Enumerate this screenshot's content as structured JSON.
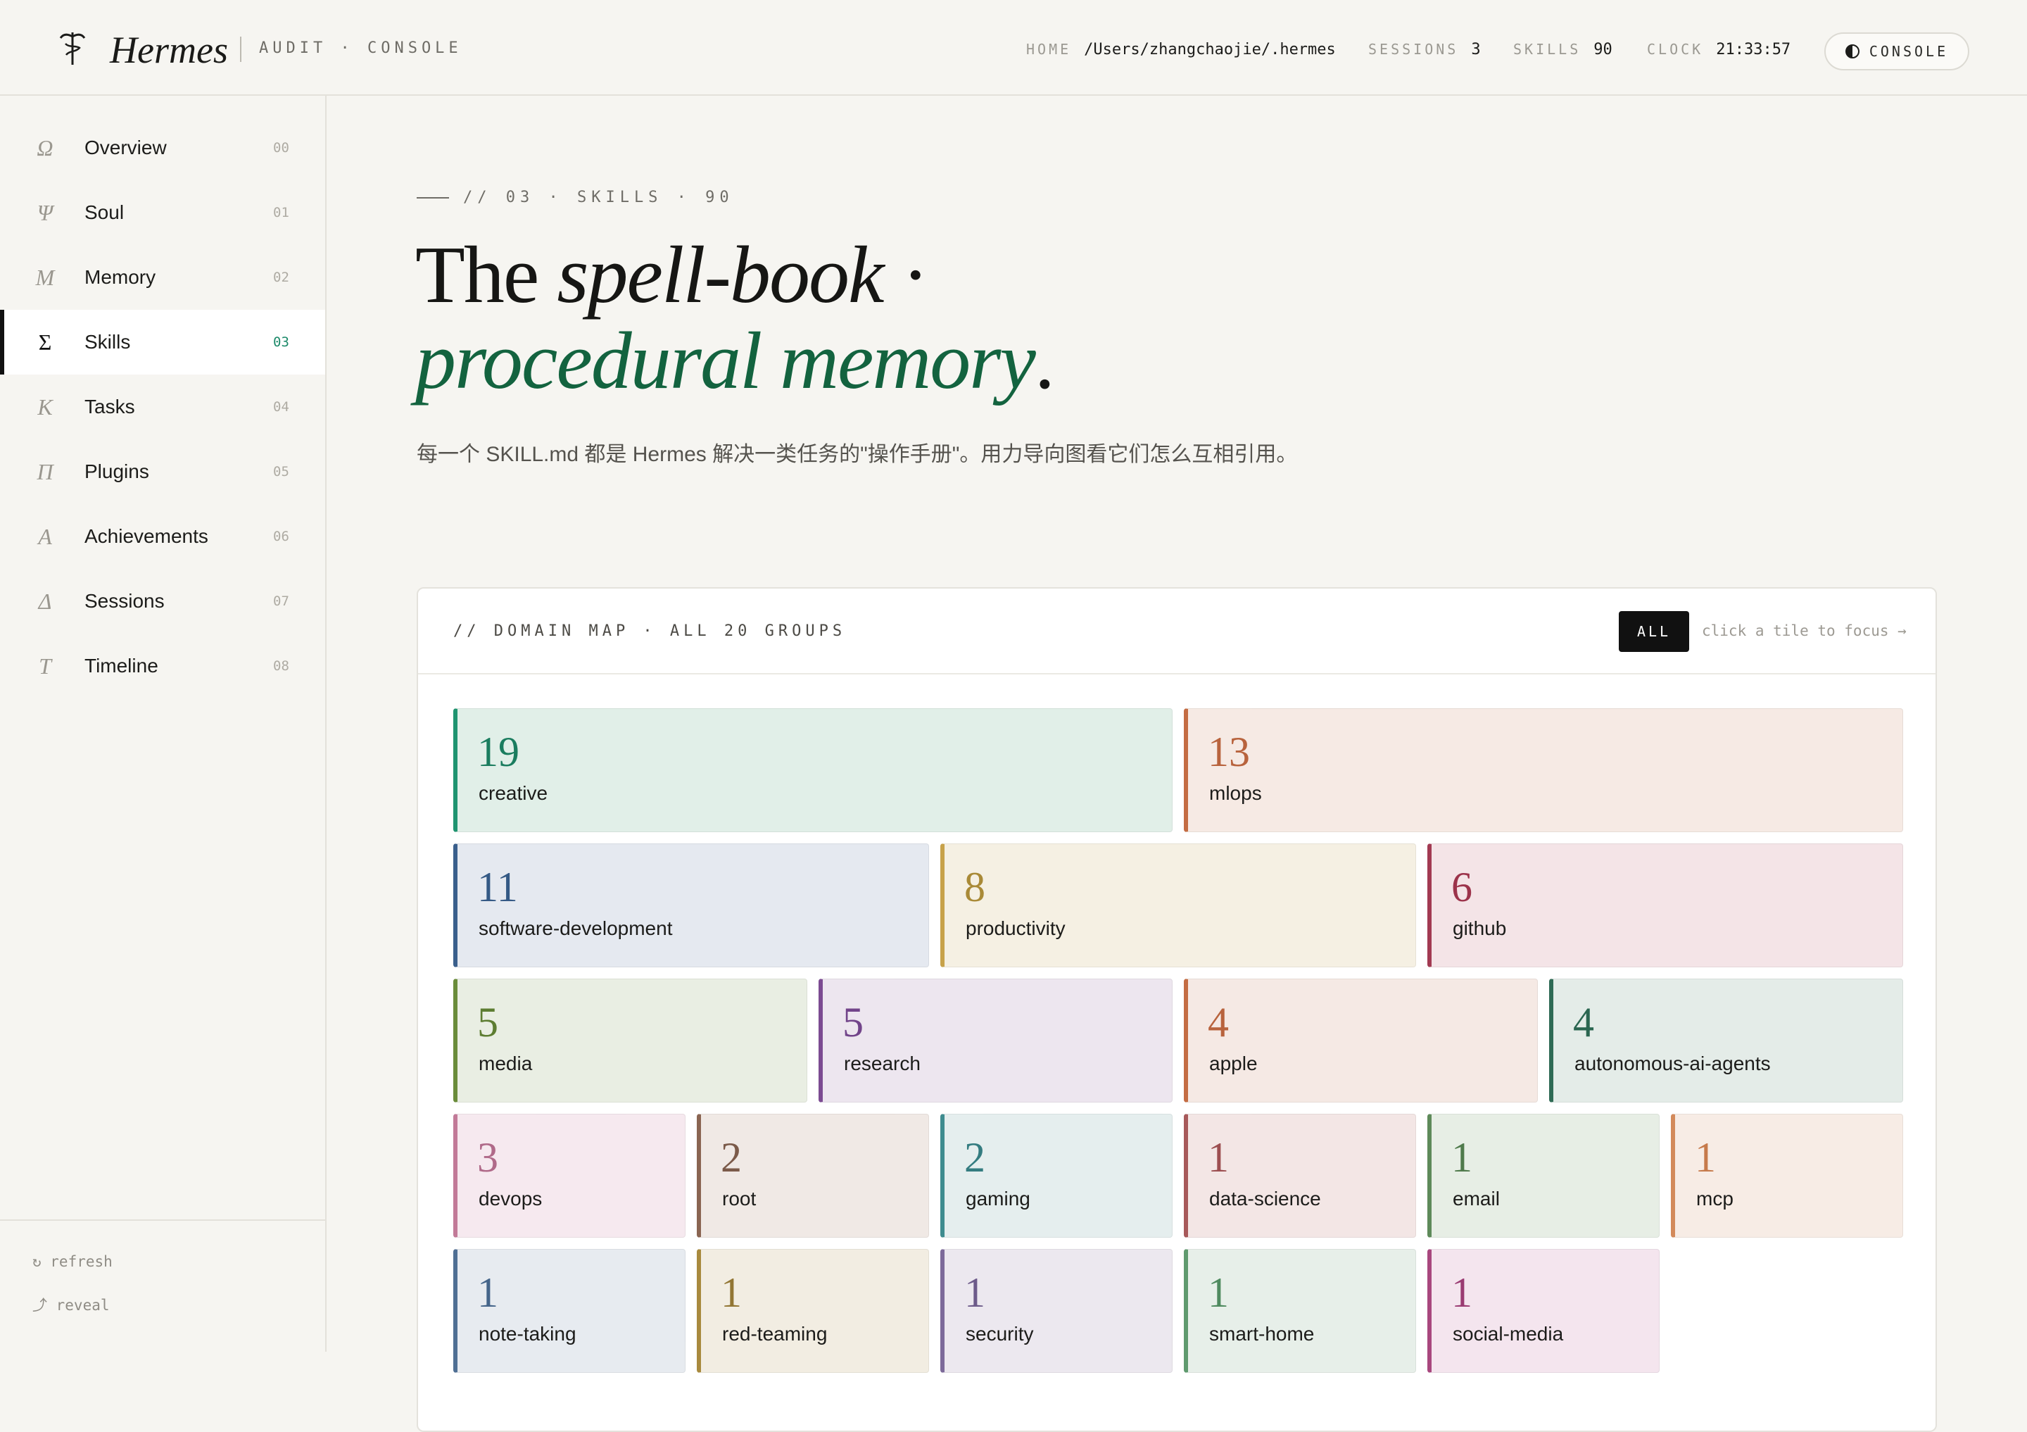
{
  "topbar": {
    "brand": "Hermes",
    "subtitle": "AUDIT · CONSOLE",
    "stats": [
      {
        "key": "HOME",
        "value": "/Users/zhangchaojie/.hermes"
      },
      {
        "key": "SESSIONS",
        "value": "3"
      },
      {
        "key": "SKILLS",
        "value": "90"
      },
      {
        "key": "CLOCK",
        "value": "21:33:57"
      }
    ],
    "console_label": "CONSOLE"
  },
  "sidebar": {
    "items": [
      {
        "glyph": "Ω",
        "label": "Overview",
        "num": "00",
        "active": false
      },
      {
        "glyph": "Ψ",
        "label": "Soul",
        "num": "01",
        "active": false
      },
      {
        "glyph": "M",
        "label": "Memory",
        "num": "02",
        "active": false
      },
      {
        "glyph": "Σ",
        "label": "Skills",
        "num": "03",
        "active": true
      },
      {
        "glyph": "K",
        "label": "Tasks",
        "num": "04",
        "active": false
      },
      {
        "glyph": "Π",
        "label": "Plugins",
        "num": "05",
        "active": false
      },
      {
        "glyph": "A",
        "label": "Achievements",
        "num": "06",
        "active": false
      },
      {
        "glyph": "Δ",
        "label": "Sessions",
        "num": "07",
        "active": false
      },
      {
        "glyph": "T",
        "label": "Timeline",
        "num": "08",
        "active": false
      }
    ],
    "footer": {
      "refresh": "↻ refresh",
      "reveal": "⤴ reveal"
    }
  },
  "main": {
    "crumb": "// 03 · SKILLS · 90",
    "hero_line1_plain": "The ",
    "hero_line1_italic": "spell-book",
    "hero_line1_tail": " ·",
    "hero_line2_green": "procedural memory",
    "hero_line2_tail": ".",
    "description": "每一个 SKILL.md 都是 Hermes 解决一类任务的\"操作手册\"。用力导向图看它们怎么互相引用。"
  },
  "panel": {
    "title": "// DOMAIN MAP · ALL 20 GROUPS",
    "all_label": "ALL",
    "hint": "click a tile to focus →",
    "tiles": [
      {
        "count": "19",
        "label": "creative",
        "accent": "#1f9470",
        "bg": "#e1efe8",
        "num_color": "#1b7d5f"
      },
      {
        "count": "13",
        "label": "mlops",
        "accent": "#c46c43",
        "bg": "#f6eae4",
        "num_color": "#b8633d"
      },
      {
        "count": "11",
        "label": "software-development",
        "accent": "#3a5f8c",
        "bg": "#e5e9f0",
        "num_color": "#345985"
      },
      {
        "count": "8",
        "label": "productivity",
        "accent": "#c7a24a",
        "bg": "#f5f0e3",
        "num_color": "#a98a37"
      },
      {
        "count": "6",
        "label": "github",
        "accent": "#a23a52",
        "bg": "#f4e4e7",
        "num_color": "#9c334b"
      },
      {
        "count": "5",
        "label": "media",
        "accent": "#6a8c3a",
        "bg": "#e9eee3",
        "num_color": "#5d7d32"
      },
      {
        "count": "5",
        "label": "research",
        "accent": "#7c4b92",
        "bg": "#ede6ef",
        "num_color": "#72448a"
      },
      {
        "count": "4",
        "label": "apple",
        "accent": "#c46c43",
        "bg": "#f5e9e4",
        "num_color": "#b8633d"
      },
      {
        "count": "4",
        "label": "autonomous-ai-agents",
        "accent": "#2f6b55",
        "bg": "#e4ece8",
        "num_color": "#2a6650"
      },
      {
        "count": "3",
        "label": "devops",
        "accent": "#c27a98",
        "bg": "#f6e9ef",
        "num_color": "#b06a89"
      },
      {
        "count": "2",
        "label": "root",
        "accent": "#8a6552",
        "bg": "#f0e9e5",
        "num_color": "#7b5a49"
      },
      {
        "count": "2",
        "label": "gaming",
        "accent": "#3f8c8f",
        "bg": "#e5eeee",
        "num_color": "#347c80"
      },
      {
        "count": "1",
        "label": "data-science",
        "accent": "#a7595a",
        "bg": "#f3e6e5",
        "num_color": "#9c4e50"
      },
      {
        "count": "1",
        "label": "email",
        "accent": "#5e8a5a",
        "bg": "#e7eee5",
        "num_color": "#4f7a4b"
      },
      {
        "count": "1",
        "label": "mcp",
        "accent": "#d38a5b",
        "bg": "#f7ece5",
        "num_color": "#c67a4b"
      },
      {
        "count": "1",
        "label": "note-taking",
        "accent": "#4f6f94",
        "bg": "#e7ebf0",
        "num_color": "#45658a"
      },
      {
        "count": "1",
        "label": "red-teaming",
        "accent": "#a88a3e",
        "bg": "#f2ede2",
        "num_color": "#927633"
      },
      {
        "count": "1",
        "label": "security",
        "accent": "#7d6a9a",
        "bg": "#ece8ef",
        "num_color": "#6d5b8a"
      },
      {
        "count": "1",
        "label": "smart-home",
        "accent": "#5f9a6e",
        "bg": "#e7efe9",
        "num_color": "#4f8a5f"
      },
      {
        "count": "1",
        "label": "social-media",
        "accent": "#a8477e",
        "bg": "#f4e5ee",
        "num_color": "#9a3b72"
      }
    ]
  }
}
